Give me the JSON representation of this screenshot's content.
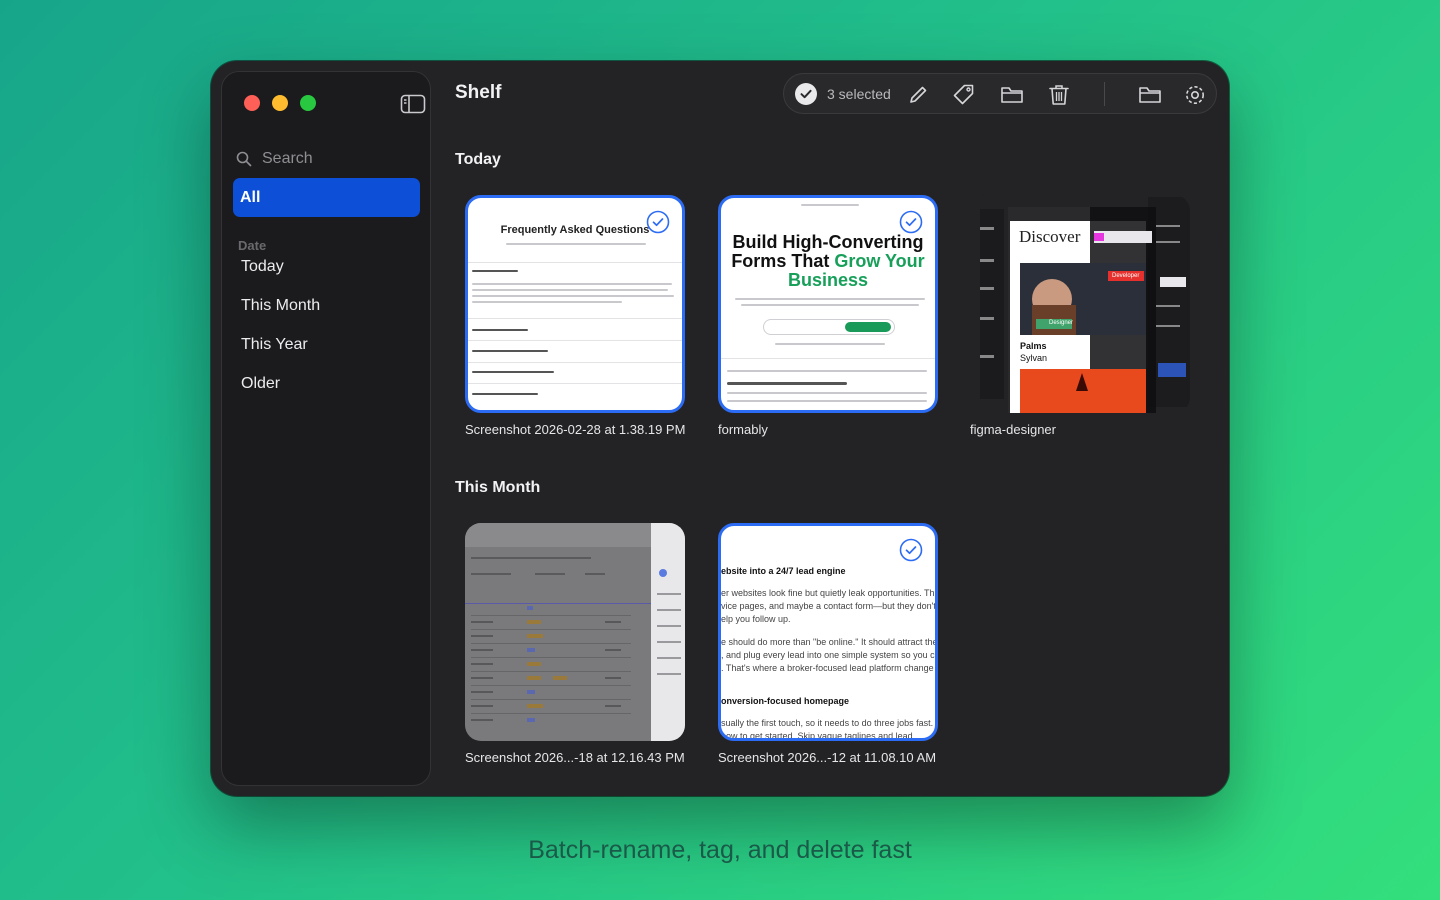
{
  "app": {
    "title": "Shelf"
  },
  "sidebar": {
    "search_placeholder": "Search",
    "all_label": "All",
    "section_label": "Date",
    "items": [
      {
        "label": "Today"
      },
      {
        "label": "This Month"
      },
      {
        "label": "This Year"
      },
      {
        "label": "Older"
      }
    ]
  },
  "toolbar": {
    "selected_count": "3 selected",
    "icons": [
      "check-circle-icon",
      "pencil-icon",
      "tag-icon",
      "folder-icon",
      "trash-icon",
      "folder-open-icon",
      "gear-icon"
    ]
  },
  "groups": [
    {
      "title": "Today",
      "items": [
        {
          "caption": "Screenshot 2026-02-28 at 1.38.19 PM",
          "selected": true,
          "thumb_heading": "Frequently Asked Questions"
        },
        {
          "caption": "formably",
          "selected": true,
          "thumb_heading_1": "Build High-Converting",
          "thumb_heading_2": "Forms That ",
          "thumb_heading_green": "Grow Your",
          "thumb_heading_3": "Business"
        },
        {
          "caption": "figma-designer",
          "selected": false,
          "thumb_heading": "Discover",
          "thumb_name_1": "Palms",
          "thumb_name_2": "Sylvan",
          "thumb_tag": "Designer",
          "thumb_tag_2": "Developer"
        }
      ]
    },
    {
      "title": "This Month",
      "items": [
        {
          "caption": "Screenshot 2026...-18 at 12.16.43 PM",
          "selected": false
        },
        {
          "caption": "Screenshot 2026...-12 at 11.08.10 AM",
          "selected": true,
          "thumb_heading": "ebsite into a 24/7 lead engine",
          "thumb_line_1": "er websites look fine but quietly leak opportunities. Th",
          "thumb_line_2": "vice pages, and maybe a contact form—but they don't c",
          "thumb_line_3": "elp you follow up.",
          "thumb_line_4": "e should do more than \"be online.\" It should attract the",
          "thumb_line_5": ", and plug every lead into one simple system so you ca",
          "thumb_line_6": ". That's where a broker-focused lead platform change",
          "thumb_heading_2": "onversion-focused homepage",
          "thumb_line_7": "sually the first touch, so it needs to do three jobs fast.",
          "thumb_line_8": "how to get started. Skip vague taglines and lead"
        }
      ]
    }
  ],
  "caption_footer": "Batch-rename, tag, and delete fast",
  "colors": {
    "accent": "#0d4fd6",
    "selection_border": "#2c6cf4",
    "window_bg": "#232325",
    "sidebar_bg": "#1b1b1d"
  }
}
